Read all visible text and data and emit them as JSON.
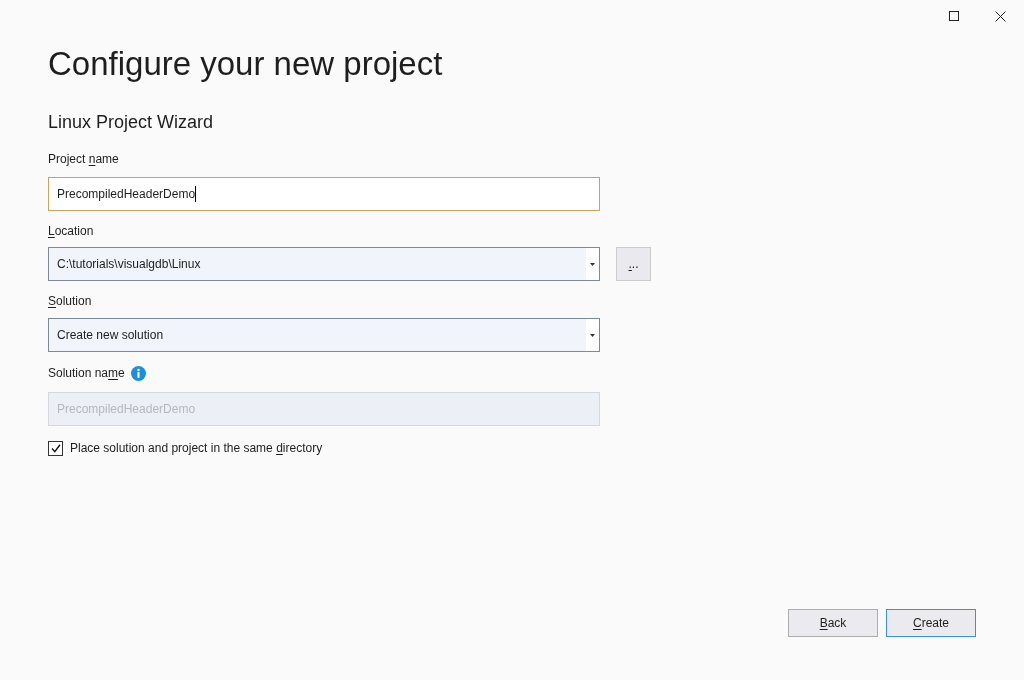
{
  "window": {
    "controls": [
      {
        "kind": "maximize"
      },
      {
        "kind": "close"
      }
    ]
  },
  "heading": "Configure your new project",
  "subheading": "Linux Project Wizard",
  "fields": [
    {
      "kind": "text",
      "label": {
        "before": "Project ",
        "key": "n",
        "after": "ame"
      },
      "value": "PrecompiledHeaderDemo",
      "focused": true,
      "disabled": false,
      "info": false
    },
    {
      "kind": "combo",
      "label": {
        "key": "L",
        "after": "ocation"
      },
      "value": "C:\\tutorials\\visualgdb\\Linux",
      "focused": false,
      "disabled": false,
      "info": false,
      "browse_button": {
        "key": ".",
        "after": ".."
      }
    },
    {
      "kind": "combo",
      "label": {
        "key": "S",
        "after": "olution"
      },
      "value": "Create new solution",
      "focused": false,
      "disabled": false,
      "info": false
    },
    {
      "kind": "text",
      "label": {
        "before": "Solution na",
        "key": "m",
        "after": "e"
      },
      "value": "PrecompiledHeaderDemo",
      "focused": false,
      "disabled": true,
      "info": true
    }
  ],
  "checkbox": {
    "label": {
      "before": "Place solution and project in the same ",
      "key": "d",
      "after": "irectory"
    },
    "checked": true
  },
  "buttons": [
    {
      "label": {
        "key": "B",
        "after": "ack"
      },
      "default": false
    },
    {
      "label": {
        "key": "C",
        "after": "reate"
      },
      "default": true
    }
  ]
}
